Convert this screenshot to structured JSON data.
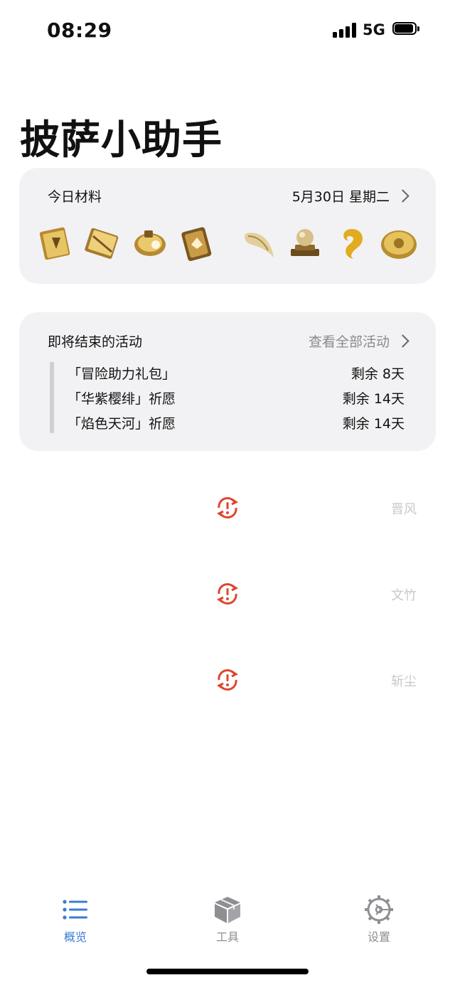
{
  "status_bar": {
    "time": "08:29",
    "network": "5G"
  },
  "page_title": "披萨小助手",
  "materials": {
    "title": "今日材料",
    "date": "5月30日 星期二",
    "items": [
      {
        "icon": "talent-book-1-icon"
      },
      {
        "icon": "talent-book-2-icon"
      },
      {
        "icon": "talent-book-3-icon"
      },
      {
        "icon": "talent-book-4-icon"
      },
      {
        "icon": "fang-material-icon"
      },
      {
        "icon": "orb-pedestal-material-icon"
      },
      {
        "icon": "curl-material-icon"
      },
      {
        "icon": "coin-material-icon"
      }
    ]
  },
  "events": {
    "title": "即将结束的活动",
    "view_all": "查看全部活动",
    "items": [
      {
        "name": "「冒险助力礼包」",
        "remaining": "剩余 8天"
      },
      {
        "name": "「华紫樱绯」祈愿",
        "remaining": "剩余 14天"
      },
      {
        "name": "「焰色天河」祈愿",
        "remaining": "剩余 14天"
      }
    ]
  },
  "characters": [
    {
      "name": "晋风"
    },
    {
      "name": "文竹"
    },
    {
      "name": "斩尘"
    }
  ],
  "tabs": [
    {
      "label": "概览",
      "icon": "list-icon",
      "active": true
    },
    {
      "label": "工具",
      "icon": "box-icon",
      "active": false
    },
    {
      "label": "设置",
      "icon": "gear-icon",
      "active": false
    }
  ],
  "colors": {
    "accent": "#3a7bd5",
    "warning": "#e0452f",
    "card_bg": "#f2f2f4",
    "muted_text": "#c9c9cc"
  }
}
